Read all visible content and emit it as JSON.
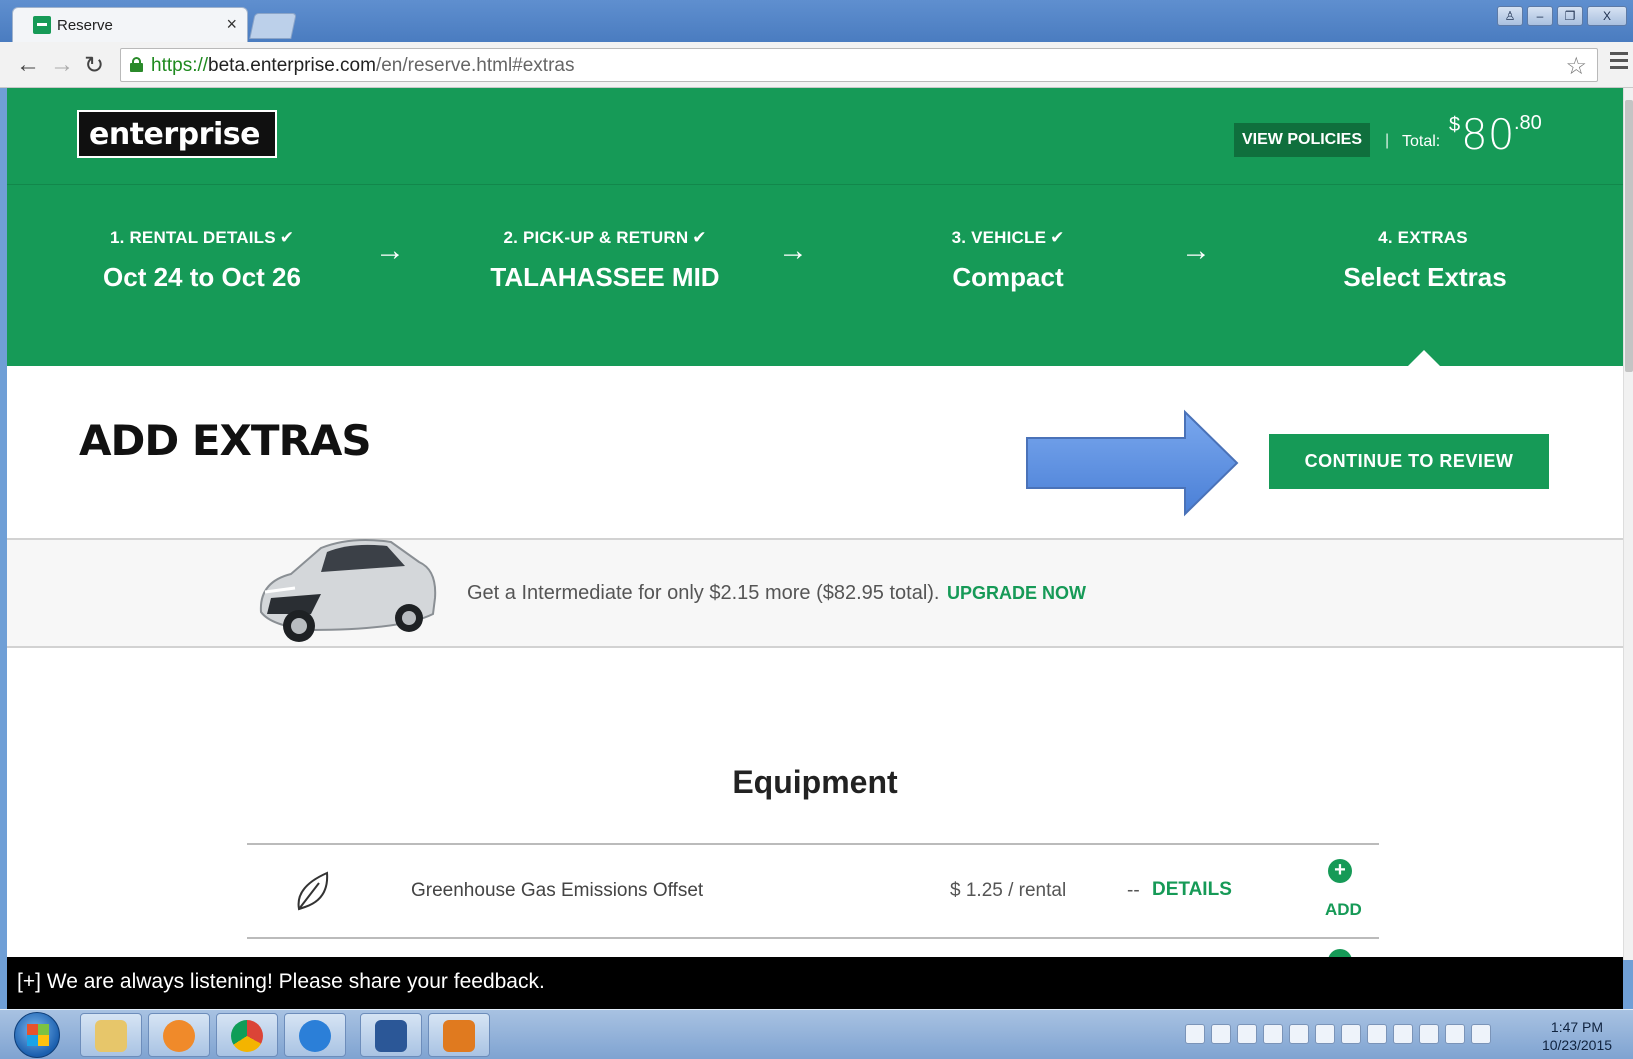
{
  "browser": {
    "tab_title": "Reserve",
    "tab_close": "×",
    "url_scheme": "https://",
    "url_host": "beta.enterprise.com",
    "url_path": "/en/reserve.html#extras",
    "window_buttons": [
      "♙",
      "–",
      "❐",
      "X"
    ]
  },
  "header": {
    "logo_text": "enterprise",
    "view_policies": "VIEW POLICIES",
    "total_separator": "|",
    "total_label": "Total:",
    "total_dollar": "$",
    "total_amount": "80",
    "total_cents": ".80"
  },
  "steps": [
    {
      "label": "1. RENTAL DETAILS",
      "check": "✔",
      "value": "Oct 24 to Oct 26"
    },
    {
      "label": "2. PICK-UP & RETURN",
      "check": "✔",
      "value": "TALAHASSEE MID"
    },
    {
      "label": "3. VEHICLE",
      "check": "✔",
      "value": "Compact"
    },
    {
      "label": "4. EXTRAS",
      "check": "",
      "value": "Select Extras"
    }
  ],
  "step_arrow": "→",
  "main": {
    "title": "ADD EXTRAS",
    "continue_button": "CONTINUE TO REVIEW"
  },
  "upsell": {
    "text": "Get a Intermediate for only $2.15 more ($82.95 total).",
    "link": "UPGRADE NOW"
  },
  "equipment": {
    "title": "Equipment",
    "rows": [
      {
        "name": "Greenhouse Gas Emissions Offset",
        "price": "$ 1.25 / rental",
        "dash": "--",
        "details": "DETAILS",
        "add_symbol": "+",
        "add_label": "ADD"
      }
    ]
  },
  "feedback": {
    "text": "[+] We are always listening! Please share your feedback."
  },
  "taskbar": {
    "time": "1:47 PM",
    "date": "10/23/2015"
  },
  "colors": {
    "brand_green": "#169a57",
    "button_dark_green": "#0f6f3d",
    "annotation_arrow": "#5b8ee0"
  }
}
